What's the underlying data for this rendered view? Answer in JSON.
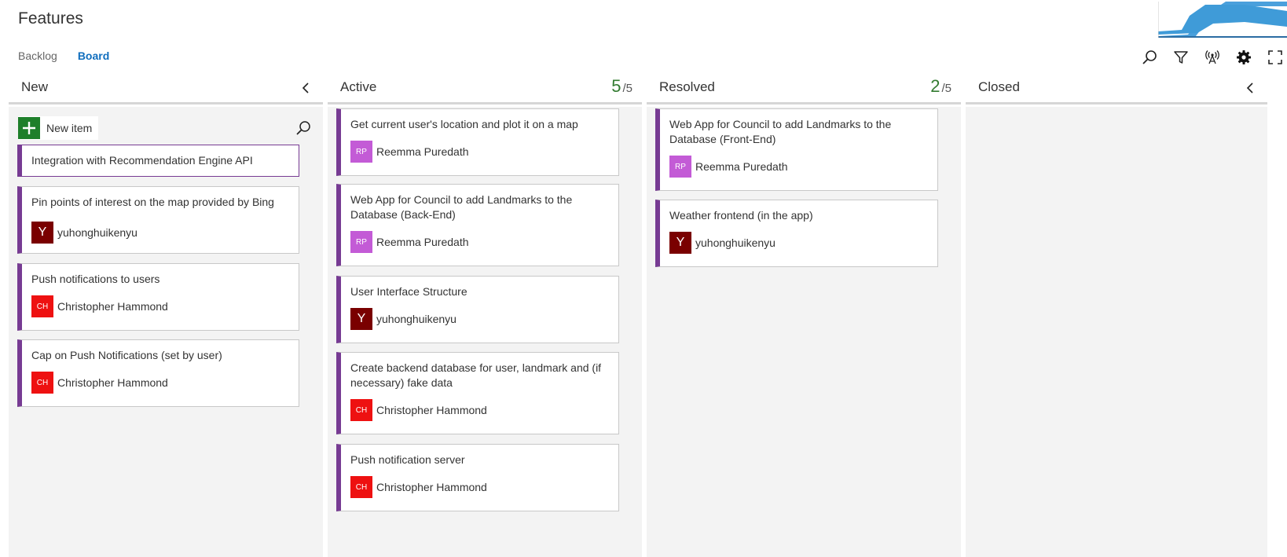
{
  "header": {
    "title": "Features"
  },
  "pivots": [
    {
      "label": "Backlog"
    },
    {
      "label": "Board"
    }
  ],
  "toolbar": {
    "icons": [
      "search-icon",
      "filter-icon",
      "live-updates-icon",
      "settings-icon",
      "fullscreen-icon"
    ]
  },
  "colors": {
    "card_accent": "#773b93",
    "active_pivot": "#106ebe",
    "new_item_green": "#1e7f2a",
    "wip_ok": "#347c32",
    "avatar_rp": "#c35bd6",
    "avatar_ch": "#ee1111",
    "avatar_y": "#7a0000"
  },
  "columns": [
    {
      "title": "New",
      "new_item_label": "New item",
      "cards": [
        {
          "title": "Integration with Recommendation Engine API"
        },
        {
          "title": "Pin points of interest on the map provided by Bing",
          "initials": "Y",
          "assignee": "yuhonghuikenyu"
        },
        {
          "title": "Push notifications to users",
          "initials": "CH",
          "assignee": "Christopher Hammond"
        },
        {
          "title": "Cap on Push Notifications (set by user)",
          "initials": "CH",
          "assignee": "Christopher Hammond"
        }
      ]
    },
    {
      "title": "Active",
      "wip_count": "5",
      "wip_sep": "/",
      "wip_limit": "5",
      "cards": [
        {
          "title": "Get current user's location and plot it on a map",
          "initials": "RP",
          "assignee": "Reemma Puredath"
        },
        {
          "title": "Web App for Council to add Landmarks to the Database (Back-End)",
          "initials": "RP",
          "assignee": "Reemma Puredath"
        },
        {
          "title": "User Interface Structure",
          "initials": "Y",
          "assignee": "yuhonghuikenyu"
        },
        {
          "title": "Create backend database for user, landmark and (if necessary) fake data",
          "initials": "CH",
          "assignee": "Christopher Hammond"
        },
        {
          "title": "Push notification server",
          "initials": "CH",
          "assignee": "Christopher Hammond"
        }
      ]
    },
    {
      "title": "Resolved",
      "wip_count": "2",
      "wip_sep": "/",
      "wip_limit": "5",
      "cards": [
        {
          "title": "Web App for Council to add Landmarks to the Database (Front-End)",
          "initials": "RP",
          "assignee": "Reemma Puredath"
        },
        {
          "title": "Weather frontend (in the app)",
          "initials": "Y",
          "assignee": "yuhonghuikenyu"
        }
      ]
    },
    {
      "title": "Closed",
      "cards": []
    }
  ]
}
